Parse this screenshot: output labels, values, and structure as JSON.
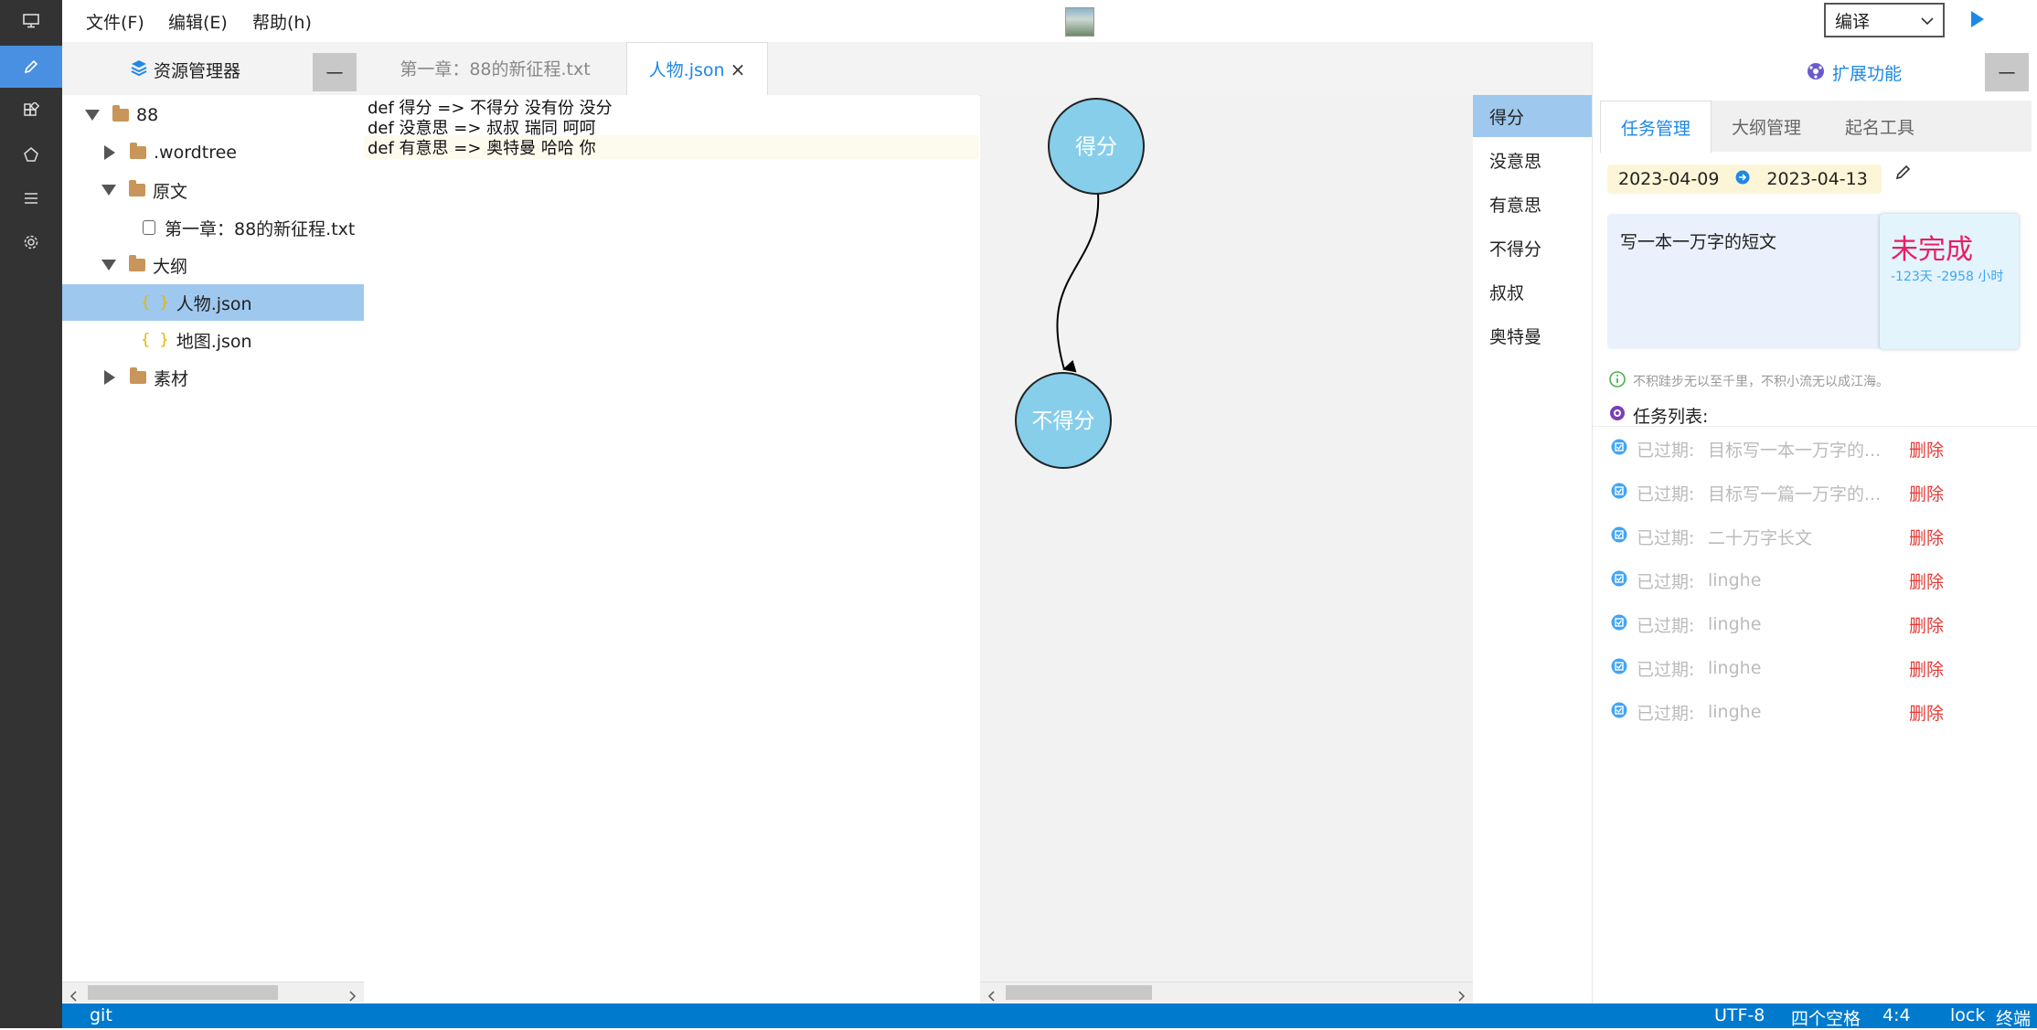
{
  "menu": {
    "file": "文件(F)",
    "edit": "编辑(E)",
    "help": "帮助(h)"
  },
  "compile": {
    "selected": "编译"
  },
  "explorer": {
    "title": "资源管理器",
    "collapse": "—",
    "tree": [
      {
        "label": "88",
        "type": "folder",
        "open": true
      },
      {
        "label": ".wordtree",
        "type": "folder",
        "open": false
      },
      {
        "label": "原文",
        "type": "folder",
        "open": true
      },
      {
        "label": "第一章：88的新征程.txt",
        "type": "txt"
      },
      {
        "label": "大纲",
        "type": "folder",
        "open": true
      },
      {
        "label": "人物.json",
        "type": "json",
        "selected": true
      },
      {
        "label": "地图.json",
        "type": "json"
      },
      {
        "label": "素材",
        "type": "folder",
        "open": false
      }
    ]
  },
  "tabs": [
    {
      "label": "第一章：88的新征程.txt"
    },
    {
      "label": "人物.json",
      "active": true,
      "close": "×"
    }
  ],
  "editor": {
    "lines": [
      "def 得分 => 不得分 没有份 没分",
      "def 没意思 => 叔叔 瑞同 呵呵",
      "def 有意思 => 奥特曼 哈哈 你"
    ]
  },
  "graph": {
    "nodes": [
      "得分",
      "不得分"
    ]
  },
  "characters": [
    "得分",
    "没意思",
    "有意思",
    "不得分",
    "叔叔",
    "奥特曼"
  ],
  "right_panel": {
    "header": "扩展功能",
    "collapse": "—",
    "tabs": [
      "任务管理",
      "大纲管理",
      "起名工具"
    ],
    "date_start": "2023-04-09",
    "date_end": "2023-04-13",
    "task_text": "写一本一万字的短文",
    "status": "未完成",
    "status_detail": "-123天 -2958 小时",
    "motto": "不积跬步无以至千里，不积小流无以成江海。",
    "task_list_label": "任务列表:",
    "tasks": [
      {
        "status": "已过期:",
        "name": "目标写一本一万字的...",
        "action": "删除"
      },
      {
        "status": "已过期:",
        "name": "目标写一篇一万字的...",
        "action": "删除"
      },
      {
        "status": "已过期:",
        "name": "二十万字长文",
        "action": "删除"
      },
      {
        "status": "已过期:",
        "name": "linghe",
        "action": "删除"
      },
      {
        "status": "已过期:",
        "name": "linghe",
        "action": "删除"
      },
      {
        "status": "已过期:",
        "name": "linghe",
        "action": "删除"
      },
      {
        "status": "已过期:",
        "name": "linghe",
        "action": "删除"
      }
    ]
  },
  "status_bar": {
    "left": "git",
    "encoding": "UTF-8",
    "indent": "四个空格",
    "position": "4:4",
    "lock": "lock",
    "terminal": "终端"
  },
  "colors": {
    "accent": "#1e88e5",
    "status_bar": "#007acc",
    "selection": "#9fc8ee",
    "node": "#87ceeb",
    "danger": "#e53935",
    "pending": "#e91e63"
  }
}
